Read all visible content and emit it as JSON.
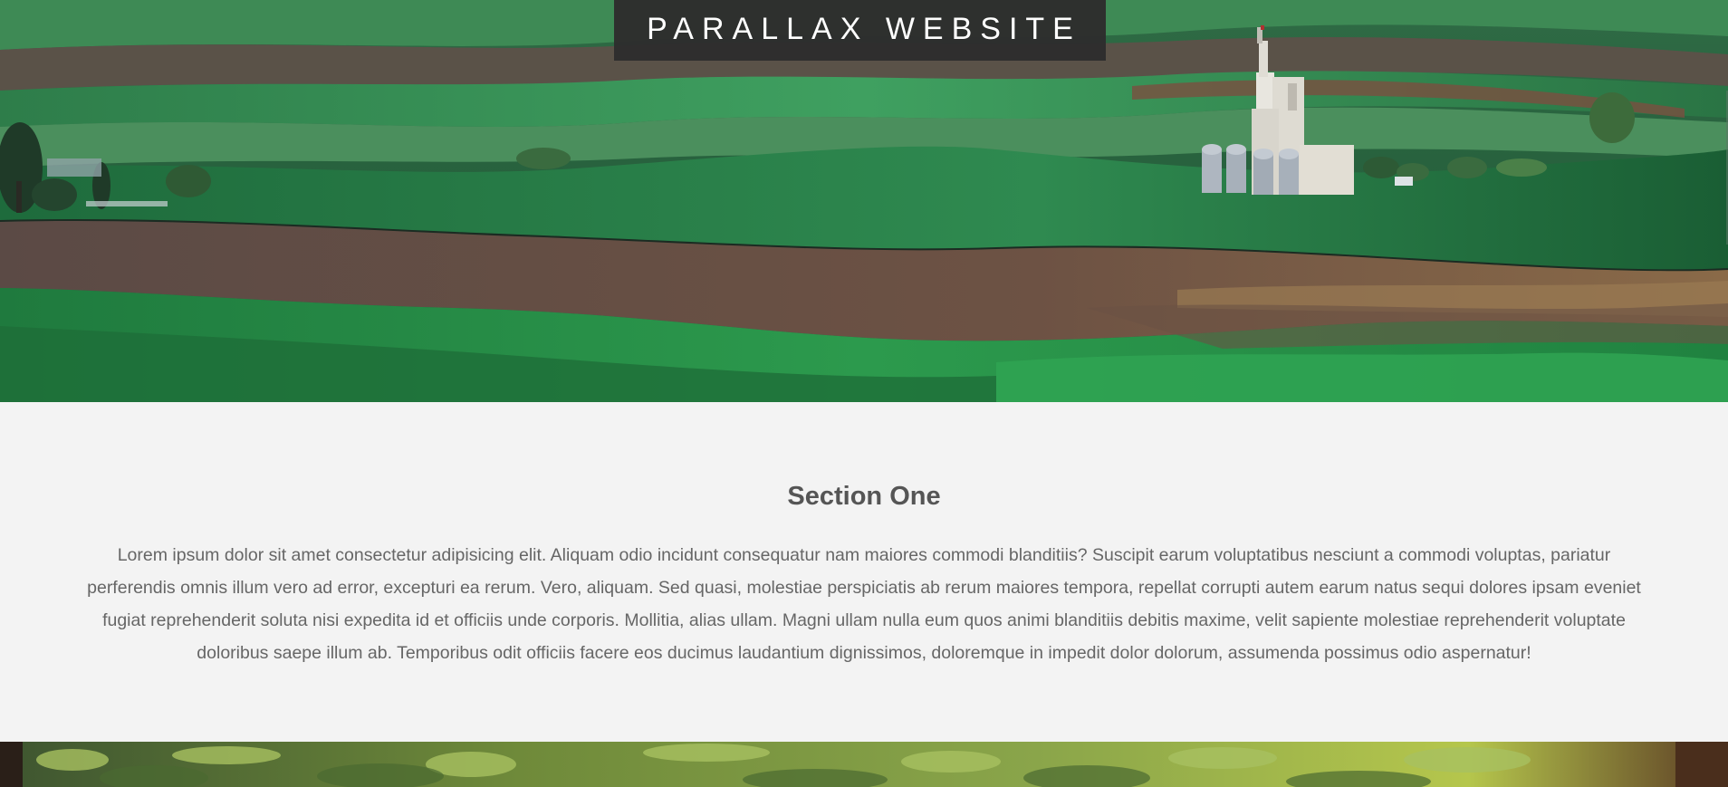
{
  "header": {
    "title": "PARALLAX WEBSITE"
  },
  "hero": {
    "image": "rolling-green-hills-with-grain-elevator"
  },
  "section_one": {
    "heading": "Section One",
    "body": "Lorem ipsum dolor sit amet consectetur adipisicing elit. Aliquam odio incidunt consequatur nam maiores commodi blanditiis? Suscipit earum voluptatibus nesciunt a commodi voluptas, pariatur perferendis omnis illum vero ad error, excepturi ea rerum. Vero, aliquam. Sed quasi, molestiae perspiciatis ab rerum maiores tempora, repellat corrupti autem earum natus sequi dolores ipsam eveniet fugiat reprehenderit soluta nisi expedita id et officiis unde corporis. Mollitia, alias ullam. Magni ullam nulla eum quos animi blanditiis debitis maxime, velit sapiente molestiae reprehenderit voluptate doloribus saepe illum ab. Temporibus odit officiis facere eos ducimus laudantium dignissimos, doloremque in impedit dolor dolorum, assumenda possimus odio aspernatur!"
  },
  "forest": {
    "image": "forest-ferns-background"
  },
  "colors": {
    "title_box": "#2d2d2d",
    "title_text": "#ffffff",
    "section_bg": "#f3f3f3",
    "heading_text": "#555555",
    "body_text": "#666666"
  }
}
